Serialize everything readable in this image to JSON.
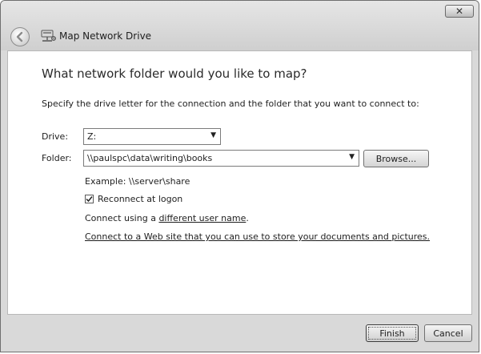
{
  "window": {
    "title": "Map Network Drive",
    "close_symbol": "✕"
  },
  "main": {
    "heading": "What network folder would you like to map?",
    "instruction": "Specify the drive letter for the connection and the folder that you want to connect to:"
  },
  "drive": {
    "label": "Drive:",
    "value": "Z:"
  },
  "folder": {
    "label": "Folder:",
    "value": "\\\\paulspc\\data\\writing\\books",
    "browse_label": "Browse...",
    "example": "Example: \\\\server\\share"
  },
  "reconnect": {
    "label": "Reconnect at logon",
    "checked": true
  },
  "connect_as": {
    "prefix": "Connect using a ",
    "link": "different user name",
    "suffix": "."
  },
  "web_link": "Connect to a Web site that you can use to store your documents and pictures.",
  "footer": {
    "finish_label": "Finish",
    "cancel_label": "Cancel"
  },
  "icons": {
    "back": "back-arrow-icon",
    "network_drive": "network-drive-icon",
    "close": "close-icon",
    "dropdown": "chevron-down-icon",
    "checkmark": "checkmark-icon"
  }
}
